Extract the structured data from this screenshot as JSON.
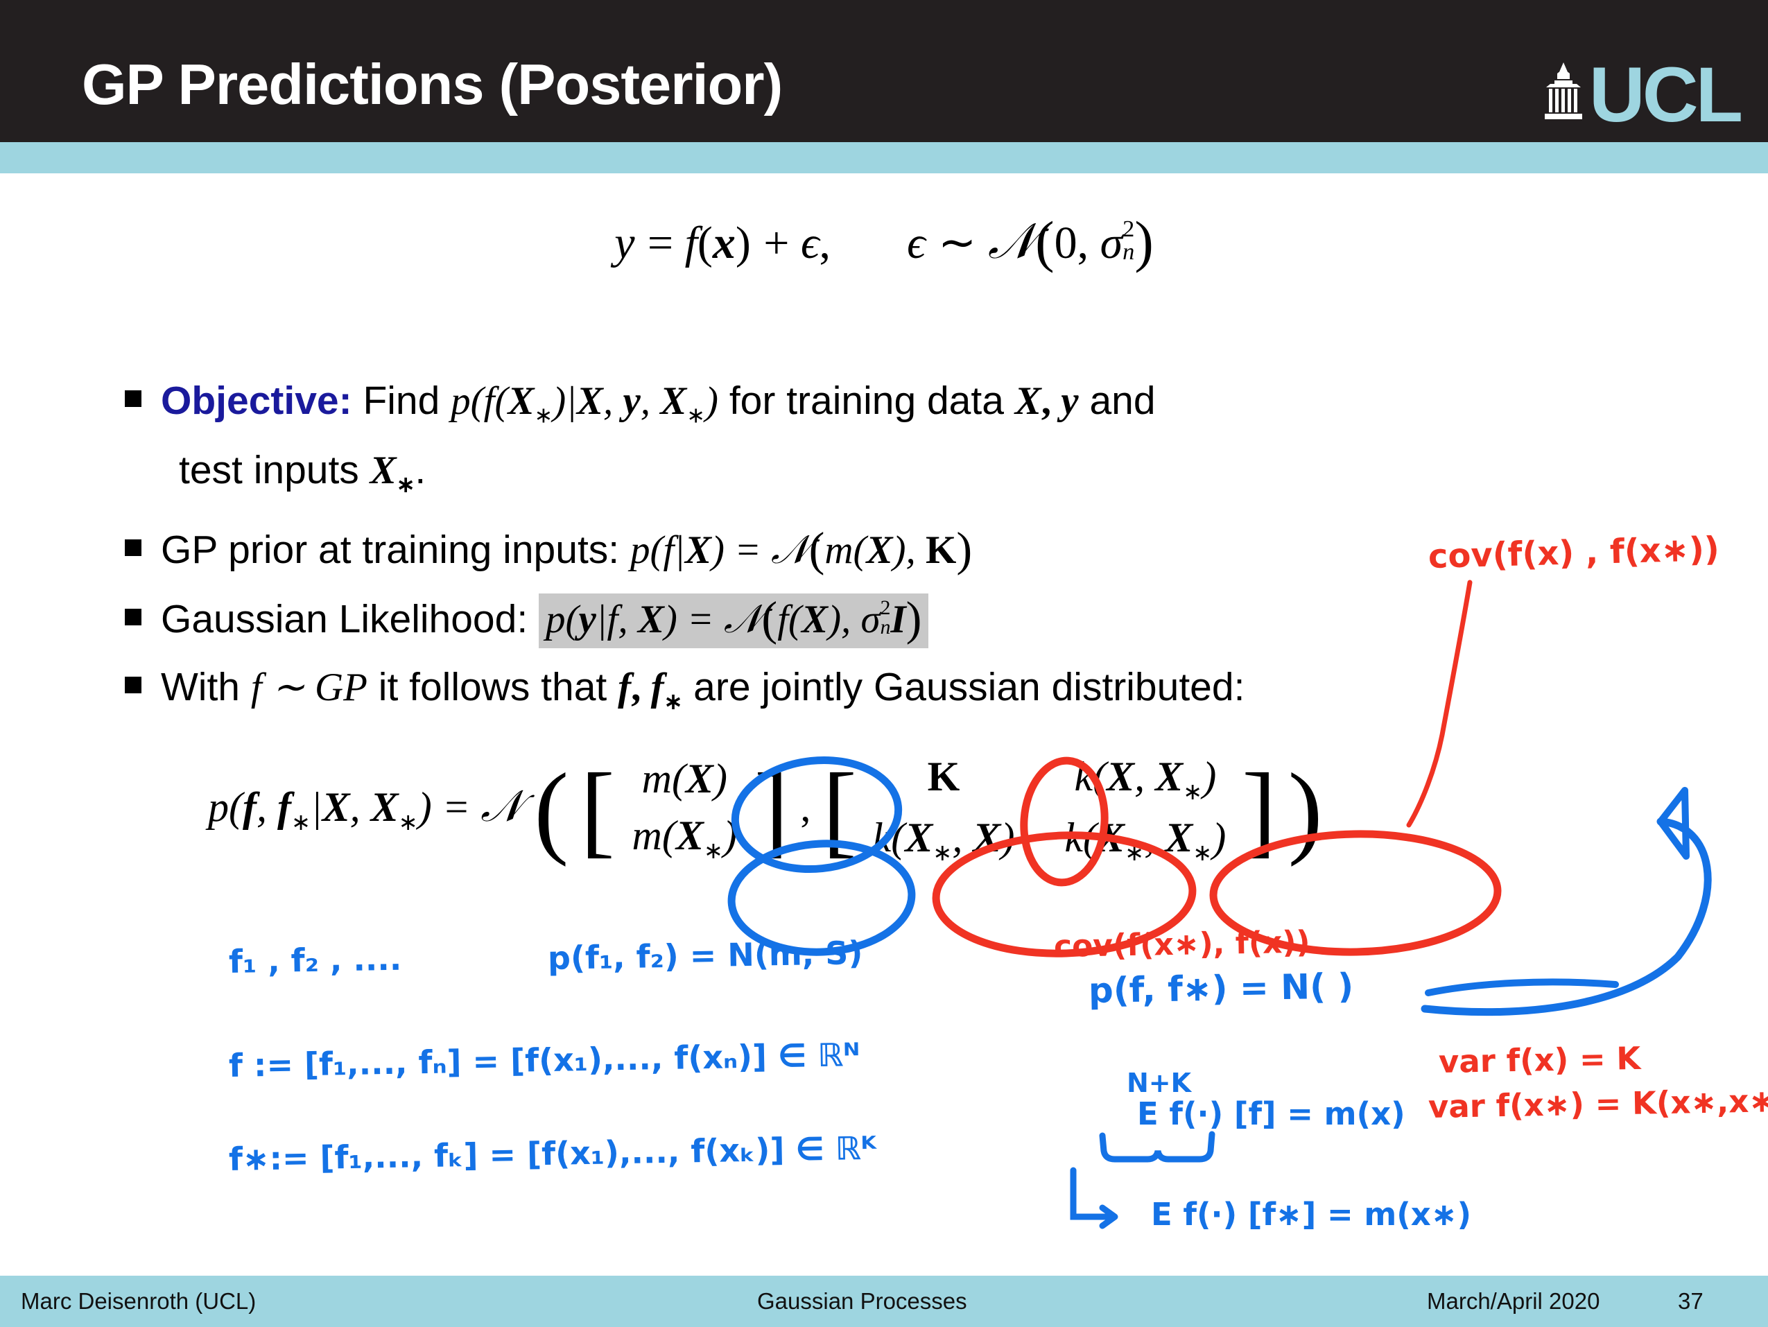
{
  "header": {
    "title": "GP Predictions (Posterior)",
    "logo_letters": "UCL",
    "logo_icon": "ucl-portico-icon",
    "bar_color": "#231f20",
    "accent_color": "#9ed5e0"
  },
  "footer": {
    "author": "Marc Deisenroth  (UCL)",
    "center": "Gaussian Processes",
    "date": "March/April 2020",
    "page": "37",
    "bar_color": "#9ed5e0"
  },
  "content": {
    "top_equation": {
      "lhs": "y",
      "eq": "=",
      "rhs": "f(x) + ϵ,",
      "noise": "ϵ ∼ N(0, σ²ₙ)",
      "full": "y = f(x) + ϵ,    ϵ ∼ N(0, σ²ₙ)"
    },
    "bullets": [
      {
        "lead": "Objective:",
        "lead_color": "#1a1a9c",
        "text_before": "Find",
        "math": "p(f(X∗)|X, y, X∗)",
        "text_after": "for training data",
        "math_tail": "X, y",
        "text_end": "and",
        "line2": "test inputs X∗."
      },
      {
        "text_before": "GP prior at training inputs:",
        "math": "p(f|X) = N(m(X), K)"
      },
      {
        "text_before": "Gaussian Likelihood:",
        "math": "p(y|f, X) = N(f(X), σ²ₙ I)",
        "highlighted": true,
        "highlight_color": "#c8c8c8"
      },
      {
        "text_before": "With f ∼ GP it follows that f, f∗ are jointly Gaussian distributed:"
      }
    ],
    "joint_equation": {
      "lhs": "p(f, f∗|X, X∗) = N",
      "mean_vector": [
        "m(X)",
        "m(X∗)"
      ],
      "cov_matrix": [
        [
          "K",
          "k(X, X∗)"
        ],
        [
          "k(X∗, X)",
          "k(X∗, X∗)"
        ]
      ]
    }
  },
  "annotations": {
    "blue_color": "#1472e6",
    "red_color": "#f03323",
    "items": [
      {
        "id": "ann-cov-top-right",
        "color": "red",
        "text": "cov(f(x) , f(x∗))"
      },
      {
        "id": "ann-cov-lower",
        "color": "red",
        "text": "cov(f(x∗), f(x))"
      },
      {
        "id": "ann-f-sequence",
        "color": "blue",
        "text": "f₁ , f₂ , ...."
      },
      {
        "id": "ann-p-f1f2",
        "color": "blue",
        "text": "p(f₁, f₂) = N(m, S)"
      },
      {
        "id": "ann-f-def",
        "color": "blue",
        "text": "f := [f₁,..., fₙ] = [f(x₁),..., f(xₙ)] ∈ ℝᴺ"
      },
      {
        "id": "ann-fstar-def",
        "color": "blue",
        "text": "f∗:= [f₁,..., fₖ] = [f(x₁),..., f(xₖ)] ∈ ℝᴷ"
      },
      {
        "id": "ann-p-joint",
        "color": "blue",
        "text": "p(f, f∗) = N(     )"
      },
      {
        "id": "ann-n-plus-k",
        "color": "blue",
        "text": "N+K"
      },
      {
        "id": "ann-expect-f",
        "color": "blue",
        "text": "E f(·) [f] = m(x)"
      },
      {
        "id": "ann-expect-fstar",
        "color": "blue",
        "text": "E f(·) [f∗] = m(x∗)"
      },
      {
        "id": "ann-var-f",
        "color": "red",
        "text": "var f(x) = K"
      },
      {
        "id": "ann-var-fstar",
        "color": "red",
        "text": "var f(x∗) = K(x∗,x∗)"
      }
    ]
  }
}
